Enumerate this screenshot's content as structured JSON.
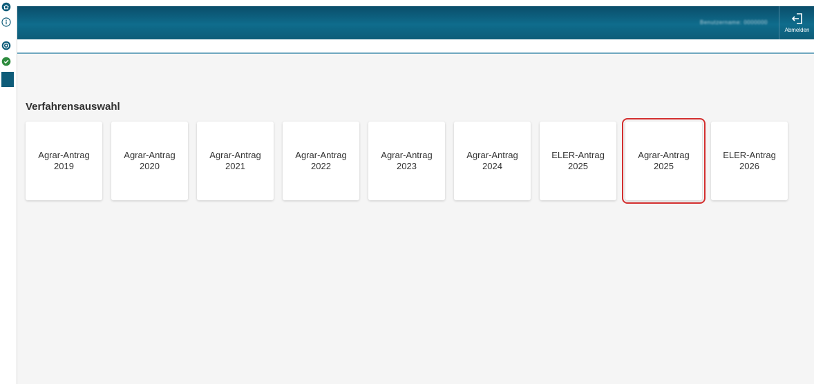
{
  "sidebar": {
    "icons": [
      "home-icon",
      "info-icon",
      "at-sign-icon",
      "check-circle-icon",
      "menu-block"
    ]
  },
  "header": {
    "user_display": "Benutzername: 0000000",
    "logout_label": "Abmelden",
    "logout_icon": "logout-icon"
  },
  "colors": {
    "header_blue": "#0f6c8c",
    "accent_green": "#2e8b3e",
    "highlight_red": "#d32f2f"
  },
  "main": {
    "title": "Verfahrensauswahl",
    "tiles": [
      {
        "label": "Agrar-Antrag\n2019"
      },
      {
        "label": "Agrar-Antrag\n2020"
      },
      {
        "label": "Agrar-Antrag\n2021"
      },
      {
        "label": "Agrar-Antrag\n2022"
      },
      {
        "label": "Agrar-Antrag\n2023"
      },
      {
        "label": "Agrar-Antrag\n2024"
      },
      {
        "label": "ELER-Antrag\n2025"
      },
      {
        "label": "Agrar-Antrag\n2025",
        "highlighted": true
      },
      {
        "label": "ELER-Antrag\n2026"
      }
    ]
  }
}
